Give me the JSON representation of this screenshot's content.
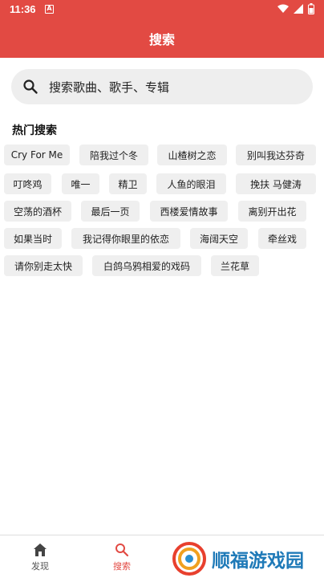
{
  "status": {
    "time": "11:36",
    "app_icon_letter": "A"
  },
  "appbar": {
    "title": "搜索"
  },
  "search": {
    "placeholder": "搜索歌曲、歌手、专辑"
  },
  "hot": {
    "title": "热门搜索",
    "tags": [
      "Cry For Me",
      "陪我过个冬",
      "山楂树之恋",
      "别叫我达芬奇",
      "叮咚鸡",
      "唯一",
      "精卫",
      "人鱼的眼泪",
      "挽扶 马健涛",
      "空荡的酒杯",
      "最后一页",
      "西楼爱情故事",
      "离别开出花",
      "如果当时",
      "我记得你眼里的依恋",
      "海阔天空",
      "牵丝戏",
      "请你别走太快",
      "白鸽乌鸦相爱的戏码",
      "兰花草"
    ]
  },
  "nav": {
    "discover": "发现",
    "search": "搜索"
  },
  "watermark": {
    "text": "顺福游戏园"
  },
  "colors": {
    "primary": "#e24a43",
    "tag_bg": "#efefef",
    "watermark": "#1f7ab8"
  }
}
